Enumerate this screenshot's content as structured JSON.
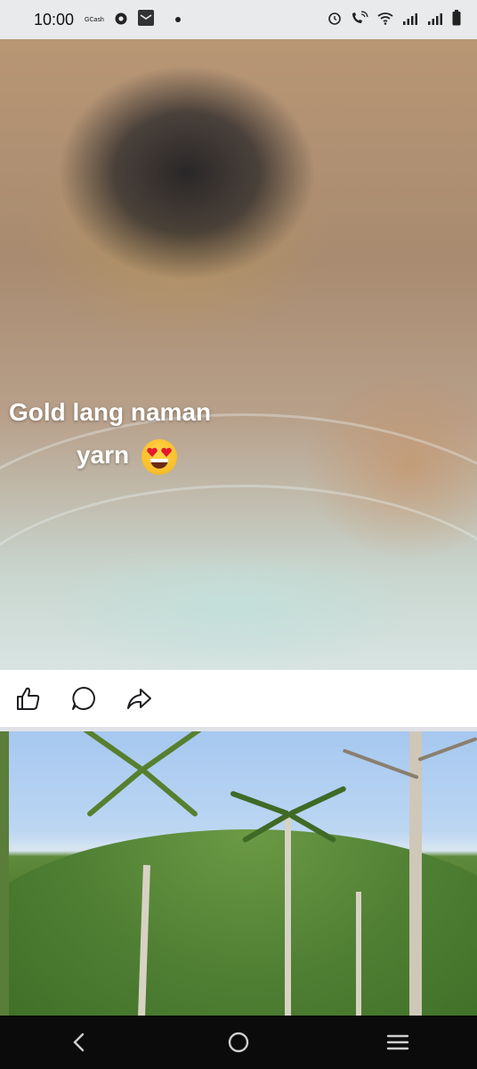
{
  "status_bar": {
    "time": "10:00",
    "app_label": "GCash",
    "icons": [
      "gcash-icon",
      "chrome-icon",
      "mail-icon",
      "notification-dot",
      "alarm-icon",
      "wifi-calling-icon",
      "wifi-icon",
      "signal-icon",
      "signal-icon-2",
      "battery-icon"
    ]
  },
  "post": {
    "caption_line1": "Gold lang naman",
    "caption_line2": "yarn",
    "emoji": "smiling-face-with-heart-eyes-icon",
    "actions": [
      {
        "name": "like",
        "icon": "thumbs-up-icon"
      },
      {
        "name": "comment",
        "icon": "comment-icon"
      },
      {
        "name": "share",
        "icon": "share-icon"
      }
    ]
  },
  "nav_bar": {
    "buttons": [
      "back-icon",
      "home-icon",
      "recents-icon"
    ]
  },
  "colors": {
    "status_bg": "#e9eaec",
    "nav_bg": "#0b0b0b",
    "divider": "#dfe2e6"
  }
}
